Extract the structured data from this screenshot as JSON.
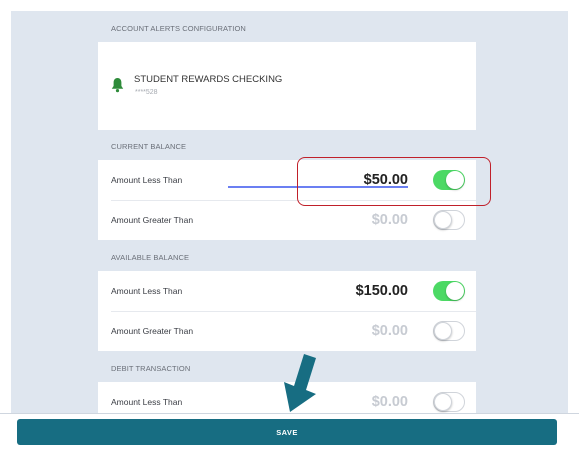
{
  "header": {
    "section_title": "ACCOUNT ALERTS CONFIGURATION"
  },
  "account": {
    "name": "STUDENT REWARDS CHECKING",
    "mask": "****528",
    "icon": "bell-icon",
    "icon_color": "#2e8b3a"
  },
  "sections": [
    {
      "title": "CURRENT BALANCE",
      "rows": [
        {
          "label": "Amount Less Than",
          "value": "$50.00",
          "enabled": true
        },
        {
          "label": "Amount Greater Than",
          "value": "$0.00",
          "enabled": false
        }
      ]
    },
    {
      "title": "AVAILABLE BALANCE",
      "rows": [
        {
          "label": "Amount Less Than",
          "value": "$150.00",
          "enabled": true
        },
        {
          "label": "Amount Greater Than",
          "value": "$0.00",
          "enabled": false
        }
      ]
    },
    {
      "title": "DEBIT TRANSACTION",
      "rows": [
        {
          "label": "Amount Less Than",
          "value": "$0.00",
          "enabled": false
        }
      ]
    }
  ],
  "footer": {
    "save_label": "SAVE"
  },
  "colors": {
    "toggle_on": "#4cd964",
    "primary": "#176d82",
    "highlight": "#c0202a",
    "background": "#dfe6ef"
  }
}
